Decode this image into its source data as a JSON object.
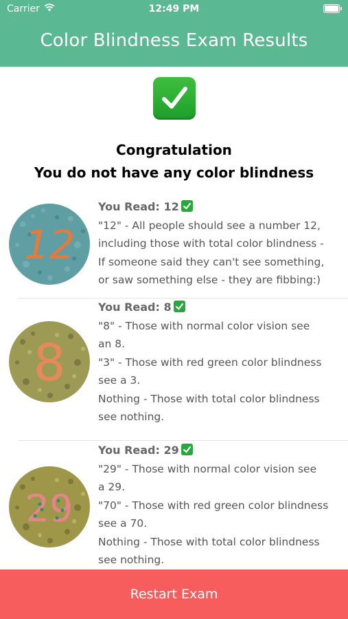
{
  "status_bar": {
    "carrier": "Carrier",
    "time": "12:49 PM"
  },
  "nav": {
    "title": "Color Blindness Exam Results"
  },
  "result": {
    "line1": "Congratulation",
    "line2": "You do not have any color blindness"
  },
  "items": [
    {
      "label": "You Read: 12",
      "lines": [
        "\"12\" - All people should see a number 12,",
        "including those with total color blindness -",
        "If someone said they can't see something,",
        "or saw something else - they are fibbing:)"
      ],
      "plate_number": "12"
    },
    {
      "label": "You Read: 8",
      "lines": [
        "\"8\" - Those with normal color vision see",
        "an 8.",
        "\"3\" - Those with red green color blindness",
        "see a 3.",
        "Nothing - Those with total color blindness",
        "see nothing."
      ],
      "plate_number": "8"
    },
    {
      "label": "You Read: 29",
      "lines": [
        "\"29\" - Those with normal color vision see",
        "a 29.",
        "\"70\" - Those with red green color blindness",
        "see a 70.",
        "Nothing - Those with total color blindness",
        "see nothing."
      ],
      "plate_number": "29"
    }
  ],
  "footer": {
    "restart_label": "Restart Exam"
  },
  "colors": {
    "header": "#5ab993",
    "restart": "#f75d5d",
    "check": "#27a83a"
  }
}
